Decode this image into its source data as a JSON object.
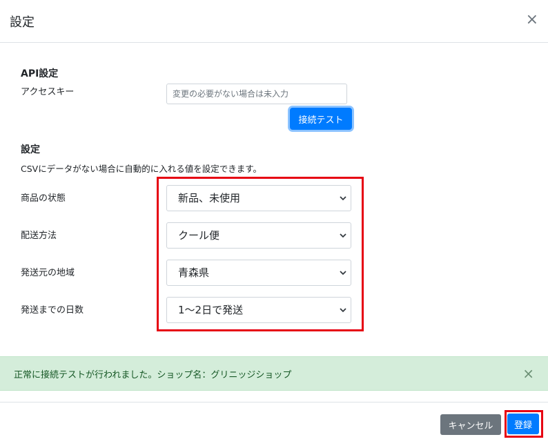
{
  "modal": {
    "title": "設定",
    "close_glyph": "×"
  },
  "api": {
    "section_title": "API設定",
    "access_key_label": "アクセスキー",
    "access_key_placeholder": "変更の必要がない場合は未入力",
    "test_button": "接続テスト"
  },
  "settings": {
    "section_title": "設定",
    "description": "CSVにデータがない場合に自動的に入れる値を設定できます。",
    "fields": [
      {
        "label": "商品の状態",
        "value": "新品、未使用"
      },
      {
        "label": "配送方法",
        "value": "クール便"
      },
      {
        "label": "発送元の地域",
        "value": "青森県"
      },
      {
        "label": "発送までの日数",
        "value": "1〜2日で発送"
      }
    ]
  },
  "alert": {
    "message": "正常に接続テストが行われました。ショップ名：グリニッジショップ",
    "close_glyph": "×"
  },
  "footer": {
    "cancel_button": "キャンセル",
    "register_button": "登録"
  },
  "colors": {
    "primary": "#007bff",
    "secondary": "#6c757d",
    "success_bg": "#d4edda",
    "highlight": "#e60012"
  }
}
